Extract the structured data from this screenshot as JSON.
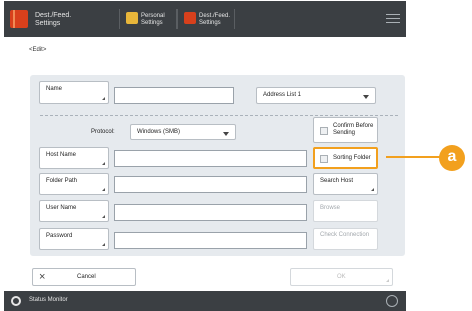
{
  "header": {
    "title": "Dest./Feed.\nSettings",
    "tab1_label": "Personal\nSettings",
    "tab2_label": "Dest./Feed.\nSettings"
  },
  "back_link": "<Edit>",
  "form": {
    "name_btn": "Name",
    "address_list": "Address List 1",
    "protocol_label": "Protocol:",
    "protocol_value": "Windows (SMB)",
    "host_name_btn": "Host Name",
    "folder_path_btn": "Folder Path",
    "user_name_btn": "User Name",
    "password_btn": "Password",
    "confirm_before_sending": "Confirm Before Sending",
    "sorting_folder": "Sorting Folder",
    "search_host": "Search Host",
    "browse": "Browse",
    "check_connection": "Check Connection"
  },
  "footer": {
    "cancel": "Cancel",
    "cancel_icon": "×",
    "ok": "OK"
  },
  "statusbar": {
    "label": "Status Monitor"
  },
  "callout": {
    "label": "a"
  },
  "colors": {
    "accent": "#f2a01e",
    "topbar": "#3b3f43",
    "form_bg": "#e6eaee"
  }
}
